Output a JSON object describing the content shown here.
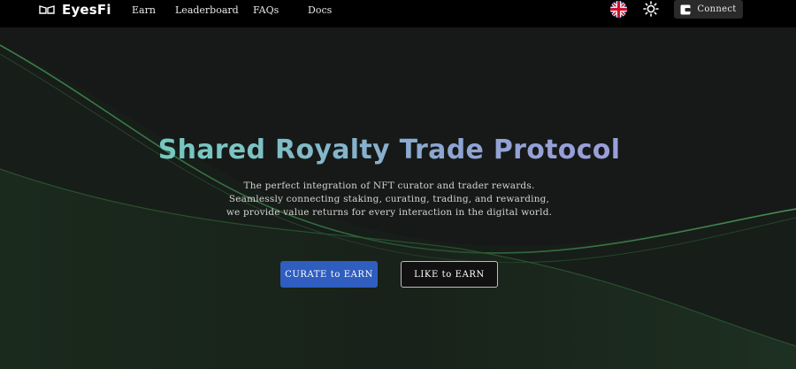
{
  "brand": {
    "name": "EyesFi"
  },
  "nav": {
    "items": [
      {
        "label": "Earn"
      },
      {
        "label": "Leaderboard"
      },
      {
        "label": "FAQs"
      },
      {
        "label": "Docs"
      }
    ]
  },
  "header": {
    "language_flag": "uk-flag-icon",
    "theme_icon": "sun-icon",
    "connect_label": "Connect"
  },
  "hero": {
    "title": "Shared Royalty Trade Protocol",
    "lines": [
      "The perfect integration of NFT curator and trader rewards.",
      "Seamlessly connecting staking, curating, trading, and rewarding,",
      "we provide value returns for every interaction in the digital world."
    ],
    "primary_button": "CURATE to EARN",
    "secondary_button": "LIKE to EARN"
  },
  "colors": {
    "accent": "#2f5ec0",
    "background": "#161917",
    "title_gradient_start": "#63d2bb",
    "title_gradient_end": "#a79ae0"
  }
}
